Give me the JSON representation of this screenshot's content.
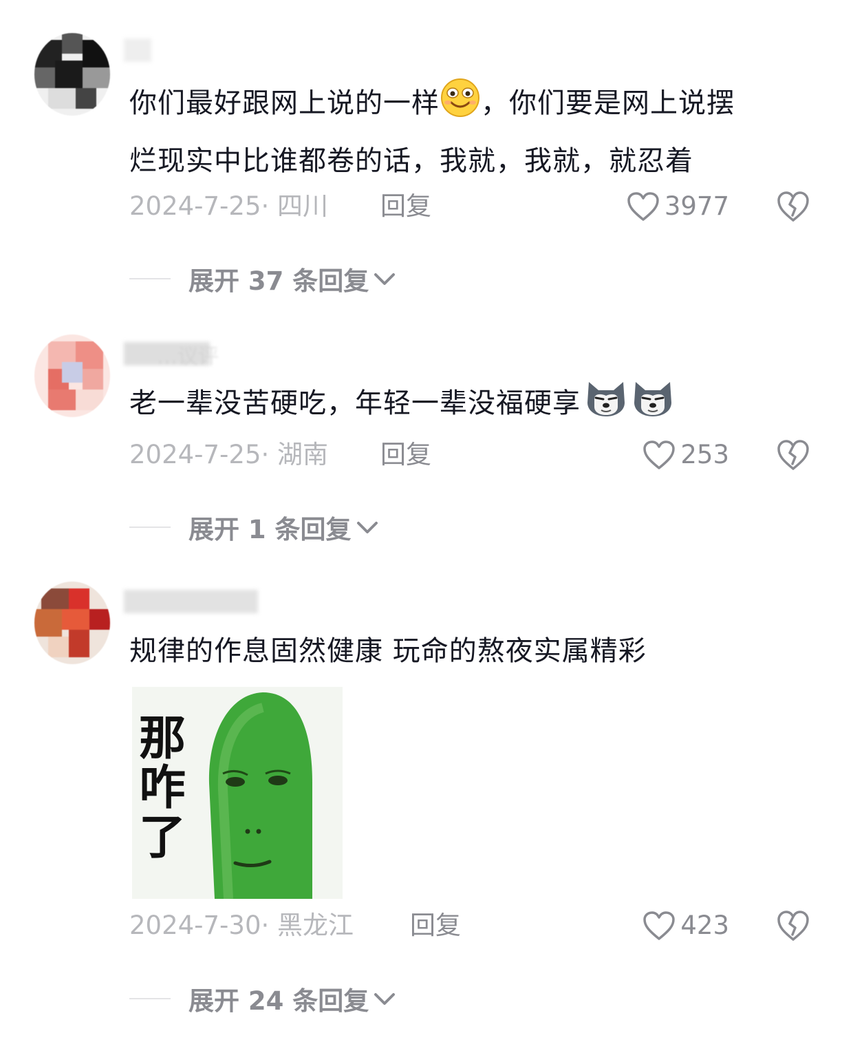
{
  "comments": [
    {
      "text_lines": [
        "你们最好跟网上说的一样",
        "，你们要是网上说摆",
        "烂现实中比谁都卷的话，我就，我就，就忍着"
      ],
      "date": "2024-7-25",
      "location": "四川",
      "reply_label": "回复",
      "likes": "3977",
      "expand_label": "展开 37 条回复",
      "avatar_colors": [
        "#111111",
        "#3a3a3a",
        "#eeeeee",
        "#777777"
      ]
    },
    {
      "username": "…议评",
      "text": "老一辈没苦硬吃，年轻一辈没福硬享",
      "date": "2024-7-25",
      "location": "湖南",
      "reply_label": "回复",
      "likes": "253",
      "expand_label": "展开 1 条回复",
      "avatar_colors": [
        "#f4b7b0",
        "#e56e64",
        "#c8cce6",
        "#f8dcd6"
      ]
    },
    {
      "text": "规律的作息固然健康 玩命的熬夜实属精彩",
      "sticker_caption": "那咋了",
      "date": "2024-7-30",
      "location": "黑龙江",
      "reply_label": "回复",
      "likes": "423",
      "expand_label": "展开 24 条回复",
      "avatar_colors": [
        "#c96a3a",
        "#d9312b",
        "#8b4a3a",
        "#f0d2c0"
      ]
    }
  ],
  "icons": {
    "like": "heart-outline-icon",
    "dislike": "broken-heart-icon",
    "expand": "chevron-down-icon",
    "smile_emoji": "smiling-face-emoji",
    "husky_emoji": "husky-dog-emoji"
  },
  "colors": {
    "text": "#161823",
    "meta": "#b6b7bb",
    "action": "#8a8b91",
    "sticker_face": "#3fa83a"
  }
}
